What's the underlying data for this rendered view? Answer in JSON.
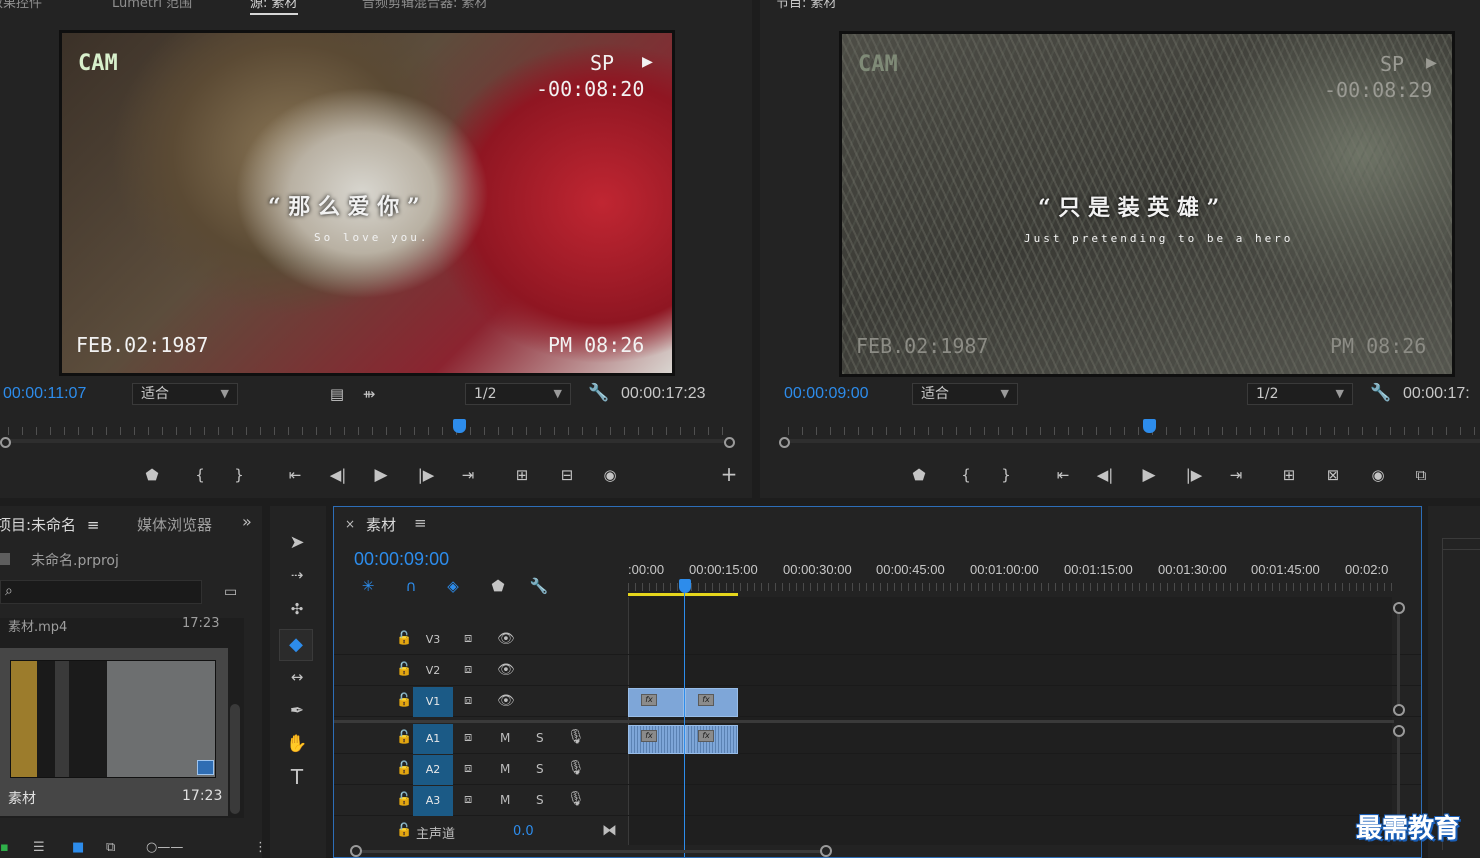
{
  "source_monitor": {
    "tabs": [
      "效果控件",
      "Lumetri 范围",
      "源: 素材",
      "音频剪辑混合器: 素材"
    ],
    "timecode_current": "00:00:11:07",
    "timecode_duration": "00:00:17:23",
    "fit": "适合",
    "resolution": "1/2",
    "video": {
      "cam": "CAM",
      "sp": "SP",
      "counter": "-00:08:20",
      "title_cn": "“ 那 么 爱 你 ”",
      "title_en": "So love you.",
      "date": "FEB.02:1987",
      "time": "PM 08:26"
    }
  },
  "program_monitor": {
    "tab": "节目: 素材",
    "timecode_current": "00:00:09:00",
    "timecode_duration": "00:00:17:",
    "fit": "适合",
    "resolution": "1/2",
    "video": {
      "cam": "CAM",
      "sp": "SP",
      "counter": "-00:08:29",
      "title_cn": "“ 只 是 装 英 雄 ”",
      "title_en": "Just pretending to be a hero",
      "date": "FEB.02:1987",
      "time": "PM 08:26"
    }
  },
  "project_panel": {
    "tab_project": "项目:未命名",
    "tab_media": "媒体浏览器",
    "project_file": "未命名.prproj",
    "partial_item_name": "素材.mp4",
    "partial_item_duration": "17:23",
    "item_name": "素材",
    "item_duration": "17:23"
  },
  "timeline": {
    "tab": "素材",
    "timecode": "00:00:09:00",
    "ruler_labels": [
      ":00:00",
      "00:00:15:00",
      "00:00:30:00",
      "00:00:45:00",
      "00:01:00:00",
      "00:01:15:00",
      "00:01:30:00",
      "00:01:45:00",
      "00:02:0"
    ],
    "video_tracks": [
      "V3",
      "V2",
      "V1"
    ],
    "audio_tracks": [
      "A1",
      "A2",
      "A3"
    ],
    "mute_label": "M",
    "solo_label": "S",
    "master_label": "主声道",
    "master_value": "0.0",
    "fx_label": "fx"
  },
  "watermark": "最需教育",
  "colors": {
    "accent": "#2d8ceb",
    "clip": "#7ea6d8",
    "track_target": "#1b5a86"
  }
}
